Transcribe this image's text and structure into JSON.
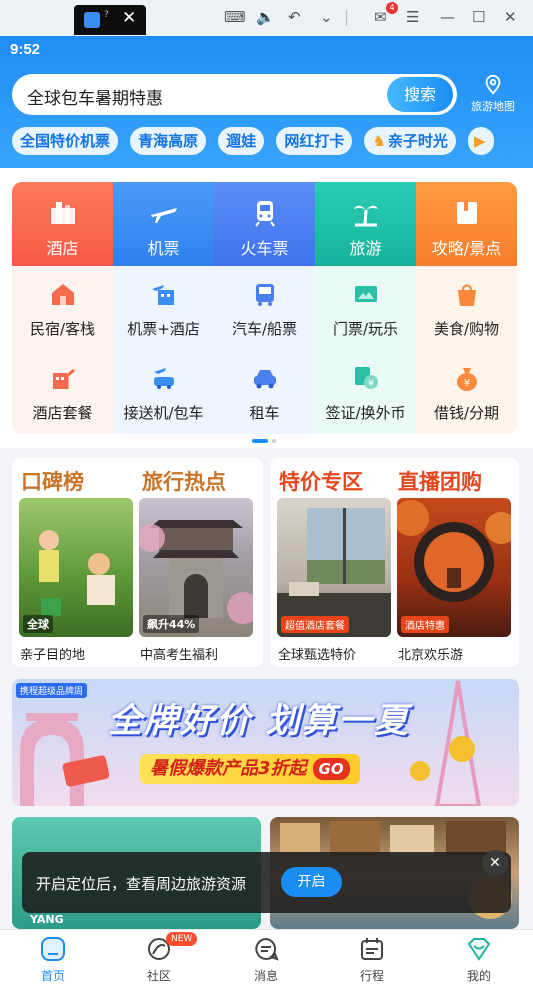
{
  "emulator": {
    "tab_mini": "?",
    "mail_badge": "4"
  },
  "status": {
    "time": "9:52"
  },
  "search": {
    "query": "全球包车暑期特惠",
    "button": "搜索",
    "map_label": "旅游地图"
  },
  "chips": [
    "全国特价机票",
    "青海高原",
    "遛娃",
    "网红打卡",
    "亲子时光"
  ],
  "grid": {
    "row1": [
      {
        "label": "酒店",
        "icon": "hotel-icon",
        "color": "#f7664f"
      },
      {
        "label": "机票",
        "icon": "plane-icon",
        "color": "#3a8ef3"
      },
      {
        "label": "火车票",
        "icon": "train-icon",
        "color": "#4a7ff0"
      },
      {
        "label": "旅游",
        "icon": "palm-icon",
        "color": "#1fbfa8"
      },
      {
        "label": "攻略/景点",
        "icon": "book-icon",
        "color": "#fb8a3c"
      }
    ],
    "row2": [
      "民宿/客栈",
      "机票+酒店",
      "汽车/船票",
      "门票/玩乐",
      "美食/购物"
    ],
    "row3": [
      "酒店套餐",
      "接送机/包车",
      "租车",
      "签证/换外币",
      "借钱/分期"
    ]
  },
  "promo_left": {
    "title1": "口碑榜",
    "title2": "旅行热点",
    "item1": {
      "tag": "全球",
      "caption": "亲子目的地"
    },
    "item2": {
      "tag": "飙升44%",
      "caption": "中高考生福利"
    }
  },
  "promo_right": {
    "title1": "特价专区",
    "title2": "直播团购",
    "item1": {
      "tag": "超值酒店套餐",
      "caption": "全球甄选特价"
    },
    "item2": {
      "tag": "酒店特惠",
      "caption": "北京欢乐游"
    }
  },
  "banner": {
    "title": "全牌好价 划算一夏",
    "subtitle": "暑假爆款产品3折起",
    "go": "GO",
    "logo": "携程超级品牌周"
  },
  "bottom_left": {
    "text": "YANG"
  },
  "toast": {
    "text": "开启定位后，查看周边旅游资源",
    "button": "开启"
  },
  "tabbar": [
    {
      "label": "首页",
      "active": true
    },
    {
      "label": "社区",
      "badge": "NEW"
    },
    {
      "label": "消息"
    },
    {
      "label": "行程"
    },
    {
      "label": "我的"
    }
  ],
  "colors": {
    "brand": "#1a8df2",
    "accent_orange": "#c8742a",
    "accent_red": "#e5481f"
  }
}
